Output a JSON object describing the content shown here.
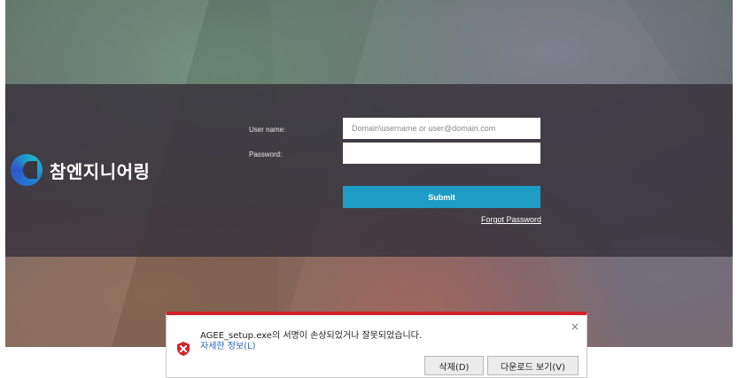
{
  "login": {
    "company_name": "참엔지니어링",
    "username_label": "User name:",
    "username_placeholder": "Domain\\username or user@domain.com",
    "password_label": "Password:",
    "submit_label": "Submit",
    "forgot_password_label": "Forgot Password"
  },
  "download_bar": {
    "message": "AGEE_setup.exe의 서명이 손상되었거나 잘못되었습니다.",
    "details_link": "자세한 정보(L)",
    "delete_label": "삭제(D)",
    "view_downloads_label": "다운로드 보기(V)",
    "close_symbol": "×"
  },
  "colors": {
    "accent": "#1d9dc6",
    "warning": "#d3232a",
    "link": "#2b63c6"
  },
  "icons": {
    "logo": "company-logo-icon",
    "warning": "shield-error-icon",
    "close": "close-icon"
  }
}
